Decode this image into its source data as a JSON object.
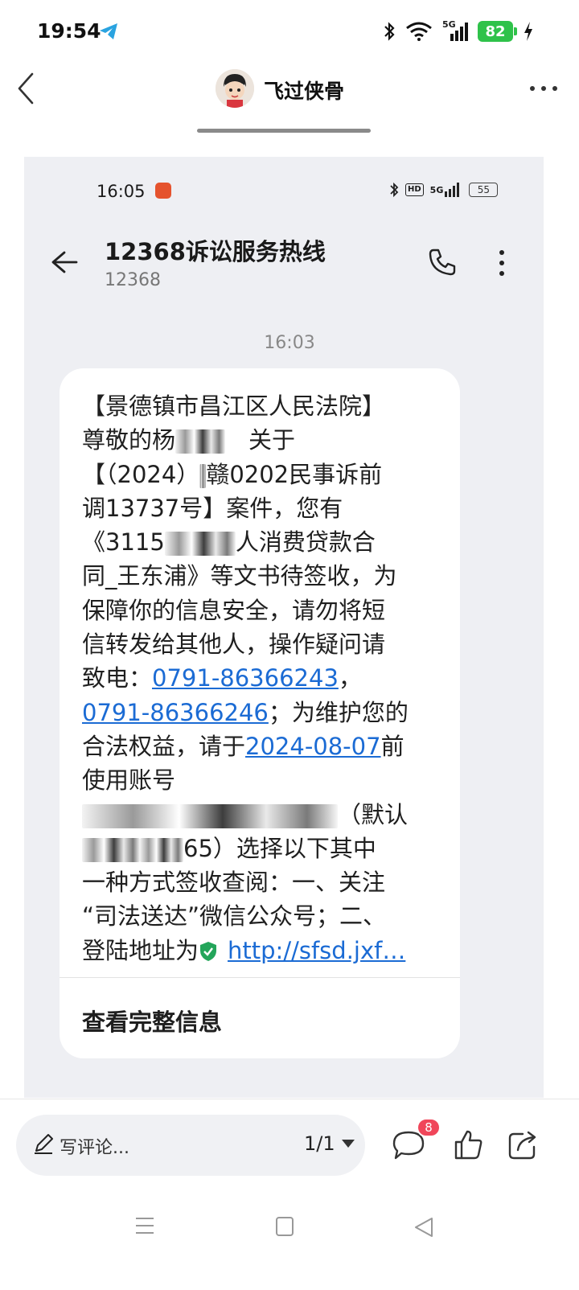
{
  "status_bar": {
    "time": "19:54",
    "network": "5G",
    "battery": "82"
  },
  "header": {
    "author": "飞过侠骨"
  },
  "screenshot": {
    "status": {
      "time": "16:05",
      "hd": "HD",
      "network": "5G",
      "battery": "55"
    },
    "contact": {
      "name": "12368诉讼服务热线",
      "number": "12368"
    },
    "message_time": "16:03",
    "message": {
      "lines": [
        {
          "parts": [
            {
              "t": "【景德镇市昌江区人民法院】"
            }
          ]
        },
        {
          "parts": [
            {
              "t": "尊敬的杨"
            },
            {
              "blur": 62
            },
            {
              "t": "　关于"
            }
          ]
        },
        {
          "parts": [
            {
              "t": "【（2024）"
            },
            {
              "blur": 8
            },
            {
              "t": "赣0202民事诉前"
            }
          ]
        },
        {
          "parts": [
            {
              "t": "调13737号】案件，您有"
            }
          ]
        },
        {
          "parts": [
            {
              "t": "《3115"
            },
            {
              "blur": 88
            },
            {
              "t": "人消费贷款合"
            }
          ]
        },
        {
          "parts": [
            {
              "t": "同_王东浦》等文书待签收，为"
            }
          ]
        },
        {
          "parts": [
            {
              "t": "保障你的信息安全，请勿将短"
            }
          ]
        },
        {
          "parts": [
            {
              "t": "信转发给其他人，操作疑问请"
            }
          ]
        },
        {
          "parts": [
            {
              "t": "致电："
            },
            {
              "link": "0791-86366243"
            },
            {
              "t": "，"
            }
          ]
        },
        {
          "parts": [
            {
              "link": "0791-86366246"
            },
            {
              "t": "；为维护您的"
            }
          ]
        },
        {
          "parts": [
            {
              "t": "合法权益，请于"
            },
            {
              "link": "2024-08-07"
            },
            {
              "t": "前"
            }
          ]
        },
        {
          "parts": [
            {
              "t": "使用账号"
            }
          ]
        },
        {
          "parts": [
            {
              "blur": 318
            },
            {
              "t": "（默认"
            }
          ]
        },
        {
          "parts": [
            {
              "blur": 72
            },
            {
              "blur": 54
            },
            {
              "t": "65）选择以下其中"
            }
          ]
        },
        {
          "parts": [
            {
              "t": "一种方式签收查阅：一、关注"
            }
          ]
        },
        {
          "parts": [
            {
              "t": "“司法送达”微信公众号；二、"
            }
          ]
        },
        {
          "parts": [
            {
              "t": "登陆地址为"
            },
            {
              "icon": "shield-check-icon"
            },
            {
              "link": "http://sfsd.jxf…"
            }
          ]
        }
      ],
      "view_full": "查看完整信息"
    }
  },
  "bottom_bar": {
    "comment_placeholder": "写评论...",
    "page_indicator": "1/1",
    "comment_count": "8"
  },
  "colors": {
    "link": "#1b6bd4",
    "badge": "#f0465a",
    "battery_green": "#2fc24a",
    "shield_green": "#23a55a",
    "panel_bg": "#eeeff3"
  }
}
